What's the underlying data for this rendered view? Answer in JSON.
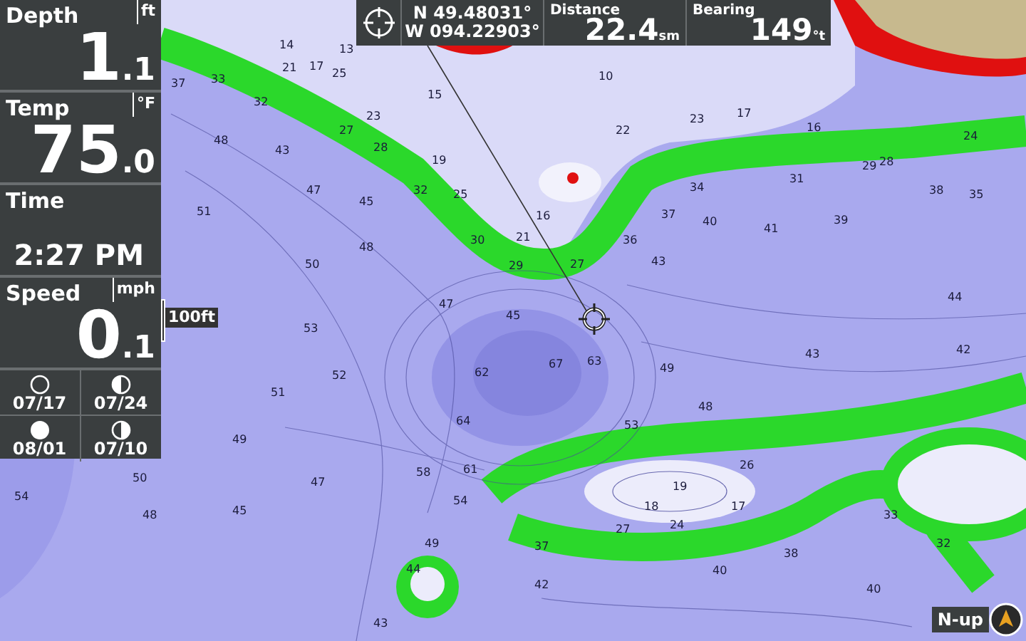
{
  "sidebar": {
    "readouts": [
      {
        "kind": "number",
        "label": "Depth",
        "unit": "ft",
        "whole": "1",
        "fraction": ".1"
      },
      {
        "kind": "number",
        "label": "Temp",
        "unit": "°F",
        "whole": "75",
        "fraction": ".0"
      },
      {
        "kind": "time",
        "label": "Time",
        "value": "2:27 PM"
      },
      {
        "kind": "number",
        "label": "Speed",
        "unit": "mph",
        "whole": "0",
        "fraction": ".1"
      }
    ],
    "moon_phases": [
      {
        "kind": "new",
        "date": "07/17"
      },
      {
        "kind": "first_quarter",
        "date": "07/24"
      },
      {
        "kind": "full",
        "date": "08/01"
      },
      {
        "kind": "last_quarter",
        "date": "07/10"
      }
    ]
  },
  "top_bar": {
    "latitude": "N 49.48031°",
    "longitude": "W 094.22903°",
    "distance": {
      "label": "Distance",
      "value": "22.4",
      "unit": "sm"
    },
    "bearing": {
      "label": "Bearing",
      "value": "149",
      "unit": "°t"
    }
  },
  "map": {
    "scale": "100ft",
    "orientation": "N-up",
    "depth_labels": [
      "37",
      "33",
      "32",
      "27",
      "28",
      "32",
      "25",
      "30",
      "29",
      "27",
      "36",
      "43",
      "34",
      "31",
      "29",
      "35",
      "42",
      "44",
      "43",
      "48",
      "43",
      "47",
      "45",
      "48",
      "50",
      "53",
      "52",
      "51",
      "62",
      "67",
      "63",
      "64",
      "58",
      "61",
      "49",
      "48",
      "45",
      "47",
      "54",
      "37",
      "27",
      "24",
      "19",
      "18",
      "17",
      "38",
      "33",
      "49",
      "44",
      "43",
      "42",
      "40",
      "45",
      "47",
      "16",
      "21",
      "15",
      "10",
      "22",
      "23",
      "17",
      "16",
      "24",
      "28",
      "38",
      "37",
      "40",
      "41",
      "39",
      "25",
      "21",
      "17",
      "13",
      "14",
      "23",
      "19",
      "54",
      "50",
      "51",
      "49",
      "48",
      "53",
      "26",
      "32",
      "40"
    ]
  }
}
